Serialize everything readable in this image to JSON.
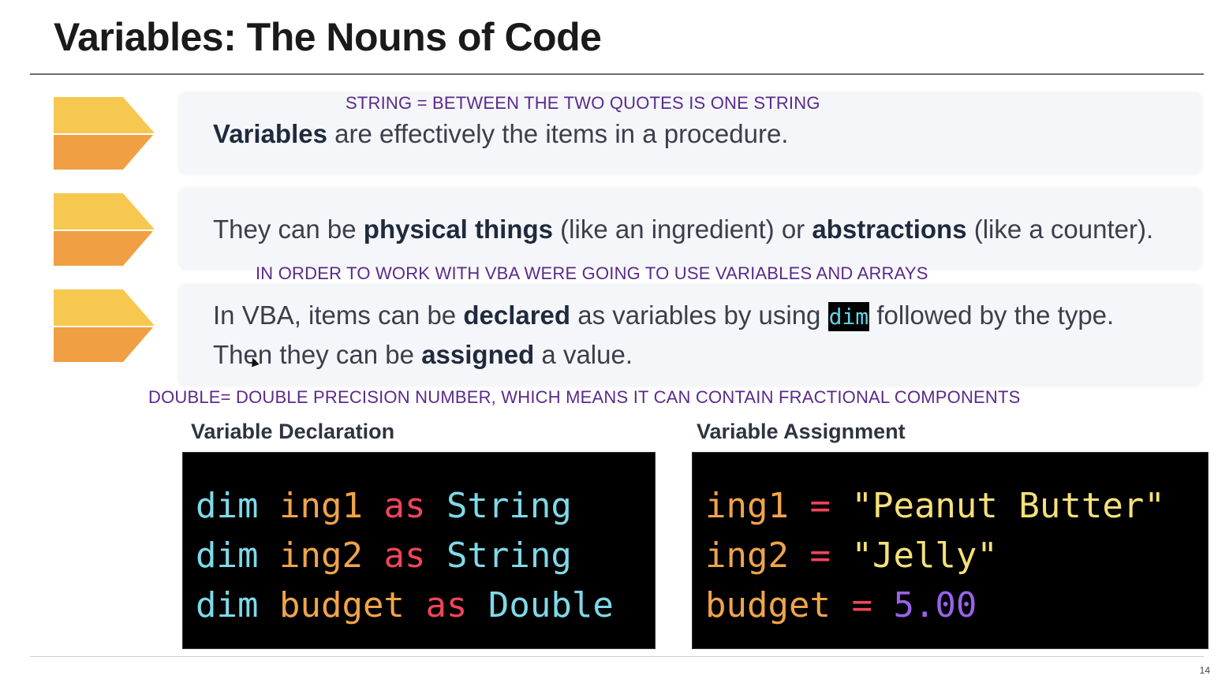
{
  "slide": {
    "title": "Variables: The Nouns of Code",
    "page_number": "14"
  },
  "colors": {
    "arrow_top": "#f6c84f",
    "arrow_bottom": "#f0a043",
    "note_text": "#5a2a8c",
    "code_background": "#000000"
  },
  "bullets": [
    {
      "bold1": "Variables",
      "text1": " are effectively the items in a procedure."
    },
    {
      "text1": "They can be ",
      "bold1": "physical things",
      "text2": " (like an ingredient) or ",
      "bold2": "abstractions",
      "text3": " (like a counter)."
    },
    {
      "text1": "In VBA, items can be ",
      "bold1": "declared",
      "text2": " as variables by using ",
      "code": "dim",
      "text3": " followed by the type.",
      "text4": "Then they can be ",
      "bold2": "assigned",
      "text5": " a value."
    }
  ],
  "notes": {
    "note1": "STRING = BETWEEN THE TWO QUOTES IS ONE STRING",
    "note2": "IN ORDER TO WORK WITH VBA WERE GOING TO USE VARIABLES AND ARRAYS",
    "note3": "DOUBLE= DOUBLE PRECISION NUMBER, WHICH MEANS IT CAN CONTAIN FRACTIONAL COMPONENTS"
  },
  "declaration": {
    "heading": "Variable Declaration",
    "lines": [
      {
        "kw": "dim",
        "name": "ing1",
        "as": "as",
        "type": "String"
      },
      {
        "kw": "dim",
        "name": "ing2",
        "as": "as",
        "type": "String"
      },
      {
        "kw": "dim",
        "name": "budget",
        "as": "as",
        "type": "Double"
      }
    ]
  },
  "assignment": {
    "heading": "Variable Assignment",
    "lines": [
      {
        "name": "ing1",
        "op": "=",
        "value": "\"Peanut Butter\""
      },
      {
        "name": "ing2",
        "op": "=",
        "value": "\"Jelly\""
      },
      {
        "name": "budget",
        "op": "=",
        "value": "5.00"
      }
    ]
  }
}
